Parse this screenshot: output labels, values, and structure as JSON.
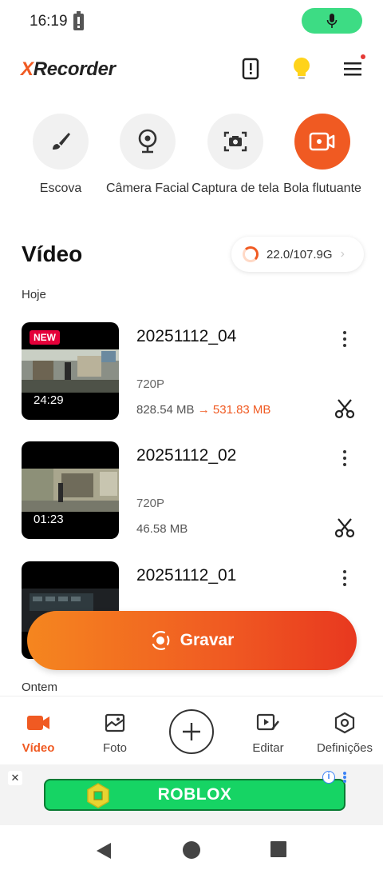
{
  "status_bar": {
    "time": "16:19"
  },
  "header": {
    "logo_x": "X",
    "logo_rest": "Recorder"
  },
  "tools": [
    {
      "label": "Escova",
      "icon": "brush-icon"
    },
    {
      "label": "Câmera Facial",
      "icon": "webcam-icon"
    },
    {
      "label": "Captura de tela",
      "icon": "screenshot-icon"
    },
    {
      "label": "Bola flutuante",
      "icon": "floating-camera-icon"
    }
  ],
  "section": {
    "title": "Vídeo",
    "storage": "22.0/107.9G"
  },
  "groups": {
    "today": "Hoje",
    "yesterday": "Ontem"
  },
  "videos": [
    {
      "title": "20251112_04",
      "badge": "NEW",
      "duration": "24:29",
      "resolution": "720P",
      "size": "828.54 MB",
      "arrow": "→",
      "new_size": "531.83 MB"
    },
    {
      "title": "20251112_02",
      "duration": "01:23",
      "resolution": "720P",
      "size": "46.58 MB"
    },
    {
      "title": "20251112_01"
    }
  ],
  "record_button": {
    "label": "Gravar"
  },
  "bottom_nav": [
    {
      "label": "Vídeo",
      "active": true
    },
    {
      "label": "Foto"
    },
    {
      "label": "Editar"
    },
    {
      "label": "Definições"
    }
  ],
  "ad": {
    "label": "ROBLOX",
    "close": "✕",
    "info": "i"
  },
  "colors": {
    "accent": "#f05a22",
    "mic_pill": "#3ddc84",
    "ad_green": "#16d464"
  }
}
